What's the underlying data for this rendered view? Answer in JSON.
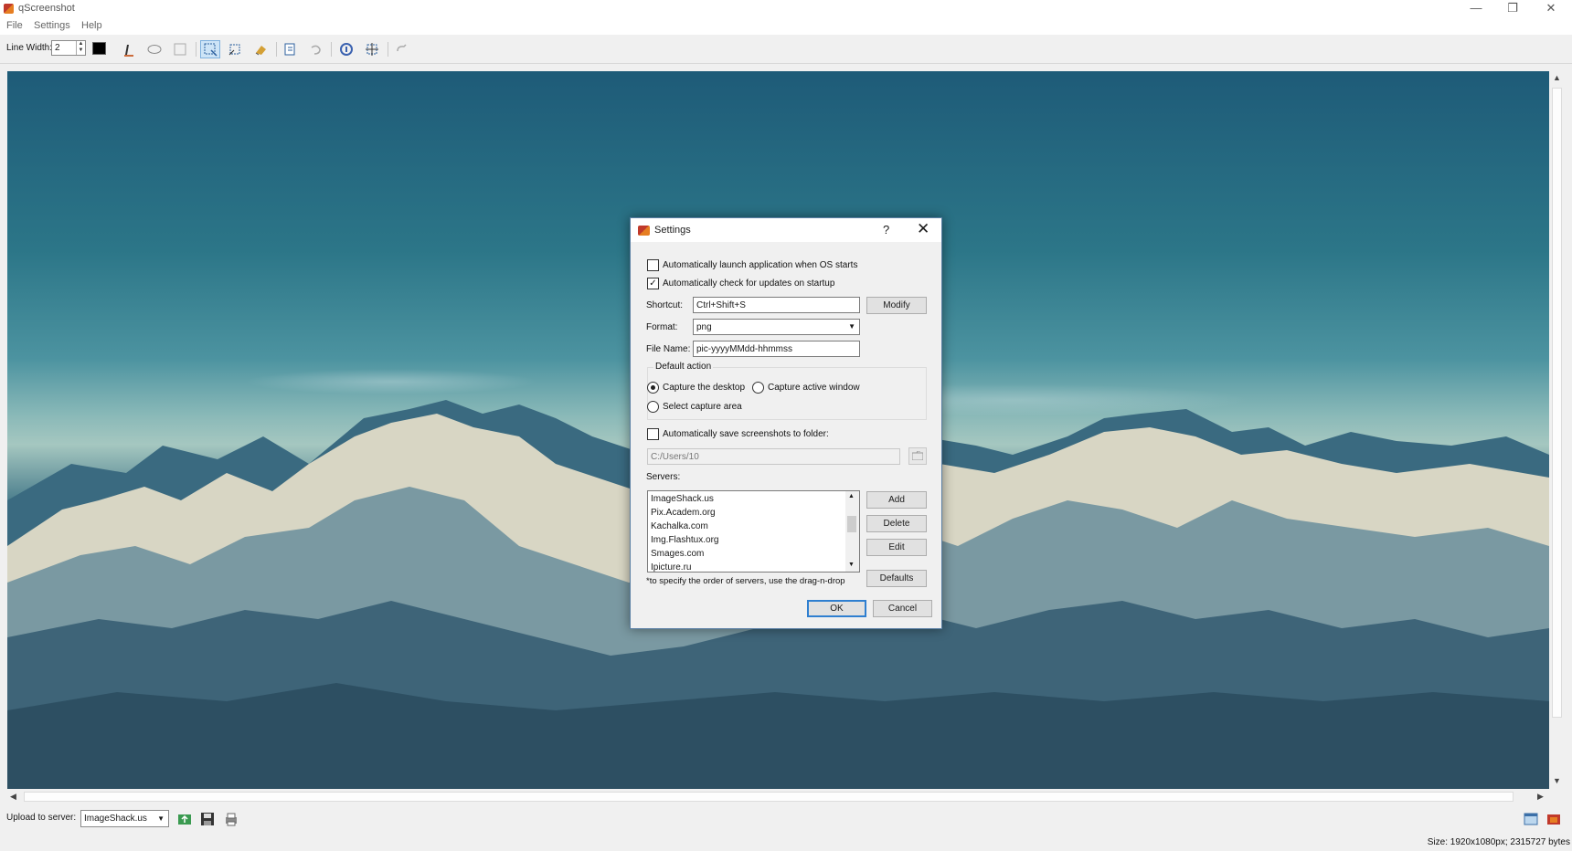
{
  "window": {
    "title": "qScreenshot"
  },
  "menu": {
    "items": [
      "File",
      "Settings",
      "Help"
    ]
  },
  "toolbar": {
    "line_width_label": "Line Width:",
    "line_width_value": "2",
    "pen_color": "#000000"
  },
  "upload": {
    "label": "Upload to server:",
    "server": "ImageShack.us"
  },
  "status": {
    "size_text": "Size: 1920x1080px; 2315727 bytes"
  },
  "dialog": {
    "title": "Settings",
    "help": "?",
    "auto_launch": {
      "label": "Automatically launch application when OS starts",
      "checked": false
    },
    "auto_update": {
      "label": "Automatically check for updates on startup",
      "checked": true
    },
    "shortcut": {
      "label": "Shortcut:",
      "value": "Ctrl+Shift+S",
      "button": "Modify"
    },
    "format": {
      "label": "Format:",
      "value": "png"
    },
    "filename": {
      "label": "File Name:",
      "value": "pic-yyyyMMdd-hhmmss"
    },
    "default_action": {
      "title": "Default action",
      "options": [
        "Capture the desktop",
        "Capture active window",
        "Select capture area"
      ],
      "selected": "Capture the desktop"
    },
    "auto_save": {
      "label": "Automatically save screenshots to folder:",
      "checked": false,
      "path": "C:/Users/10"
    },
    "servers": {
      "label": "Servers:",
      "items": [
        "ImageShack.us",
        "Pix.Academ.org",
        "Kachalka.com",
        "Img.Flashtux.org",
        "Smages.com",
        "Ipicture.ru"
      ],
      "buttons": {
        "add": "Add",
        "delete": "Delete",
        "edit": "Edit",
        "defaults": "Defaults"
      },
      "hint": "*to specify the order of servers, use the drag-n-drop"
    },
    "ok": "OK",
    "cancel": "Cancel"
  },
  "colors": {
    "accent": "#2f7fd0",
    "sky": "#2c7688",
    "snow": "#e8e4cf"
  }
}
